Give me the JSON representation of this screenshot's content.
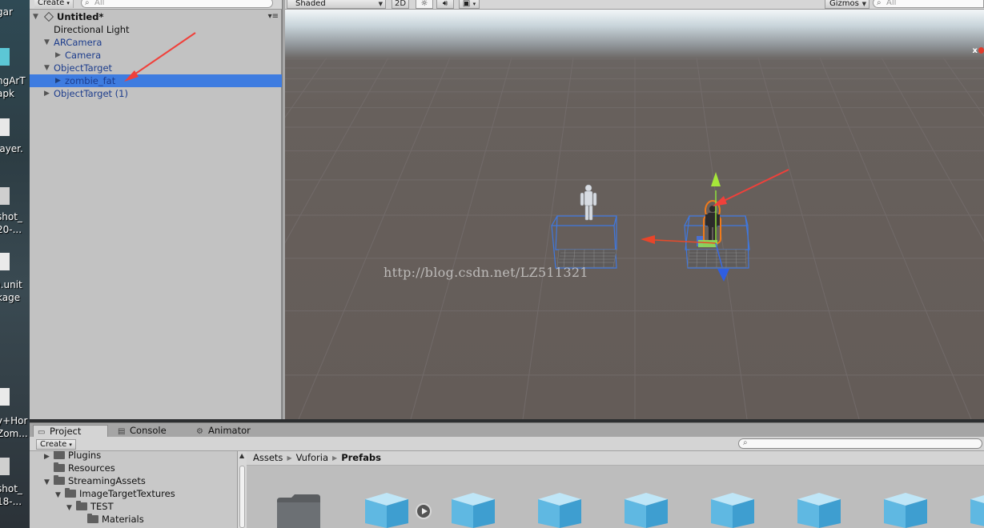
{
  "desktop": {
    "labels": [
      "gar",
      "ngArT",
      "apk",
      "layer.",
      "shot_",
      "20-...",
      ").unit",
      "kage",
      "y+Hor",
      "Zom...",
      "shot_",
      "18-..."
    ]
  },
  "hierarchy": {
    "create_label": "Create",
    "search_placeholder": "All",
    "scene_name": "Untitled*",
    "items": [
      {
        "label": "Directional Light"
      },
      {
        "label": "ARCamera"
      },
      {
        "label": "Camera"
      },
      {
        "label": "ObjectTarget"
      },
      {
        "label": "zombie_fat",
        "selected": true
      },
      {
        "label": "ObjectTarget (1)"
      }
    ]
  },
  "scene": {
    "shading_mode": "Shaded",
    "mode_2d_label": "2D",
    "gizmos_label": "Gizmos",
    "search_placeholder": "All",
    "watermark": "http://blog.csdn.net/LZ511321",
    "close_label": "x",
    "colors": {
      "sky": "#f2f6f8",
      "ground": "#645c58",
      "selection": "#3e7ce0",
      "annotation_arrow": "#f0403a",
      "bounds": "#3f78e0"
    }
  },
  "bottom": {
    "tabs": [
      {
        "label": "Project",
        "icon": "folder-icon",
        "active": true
      },
      {
        "label": "Console",
        "icon": "console-icon"
      },
      {
        "label": "Animator",
        "icon": "animator-icon"
      }
    ],
    "create_label": "Create",
    "folders": [
      {
        "label": "Plugins"
      },
      {
        "label": "Resources"
      },
      {
        "label": "StreamingAssets"
      },
      {
        "label": "ImageTargetTextures"
      },
      {
        "label": "TEST"
      },
      {
        "label": "Materials"
      }
    ],
    "breadcrumb": [
      "Assets",
      "Vuforia",
      "Prefabs"
    ]
  }
}
